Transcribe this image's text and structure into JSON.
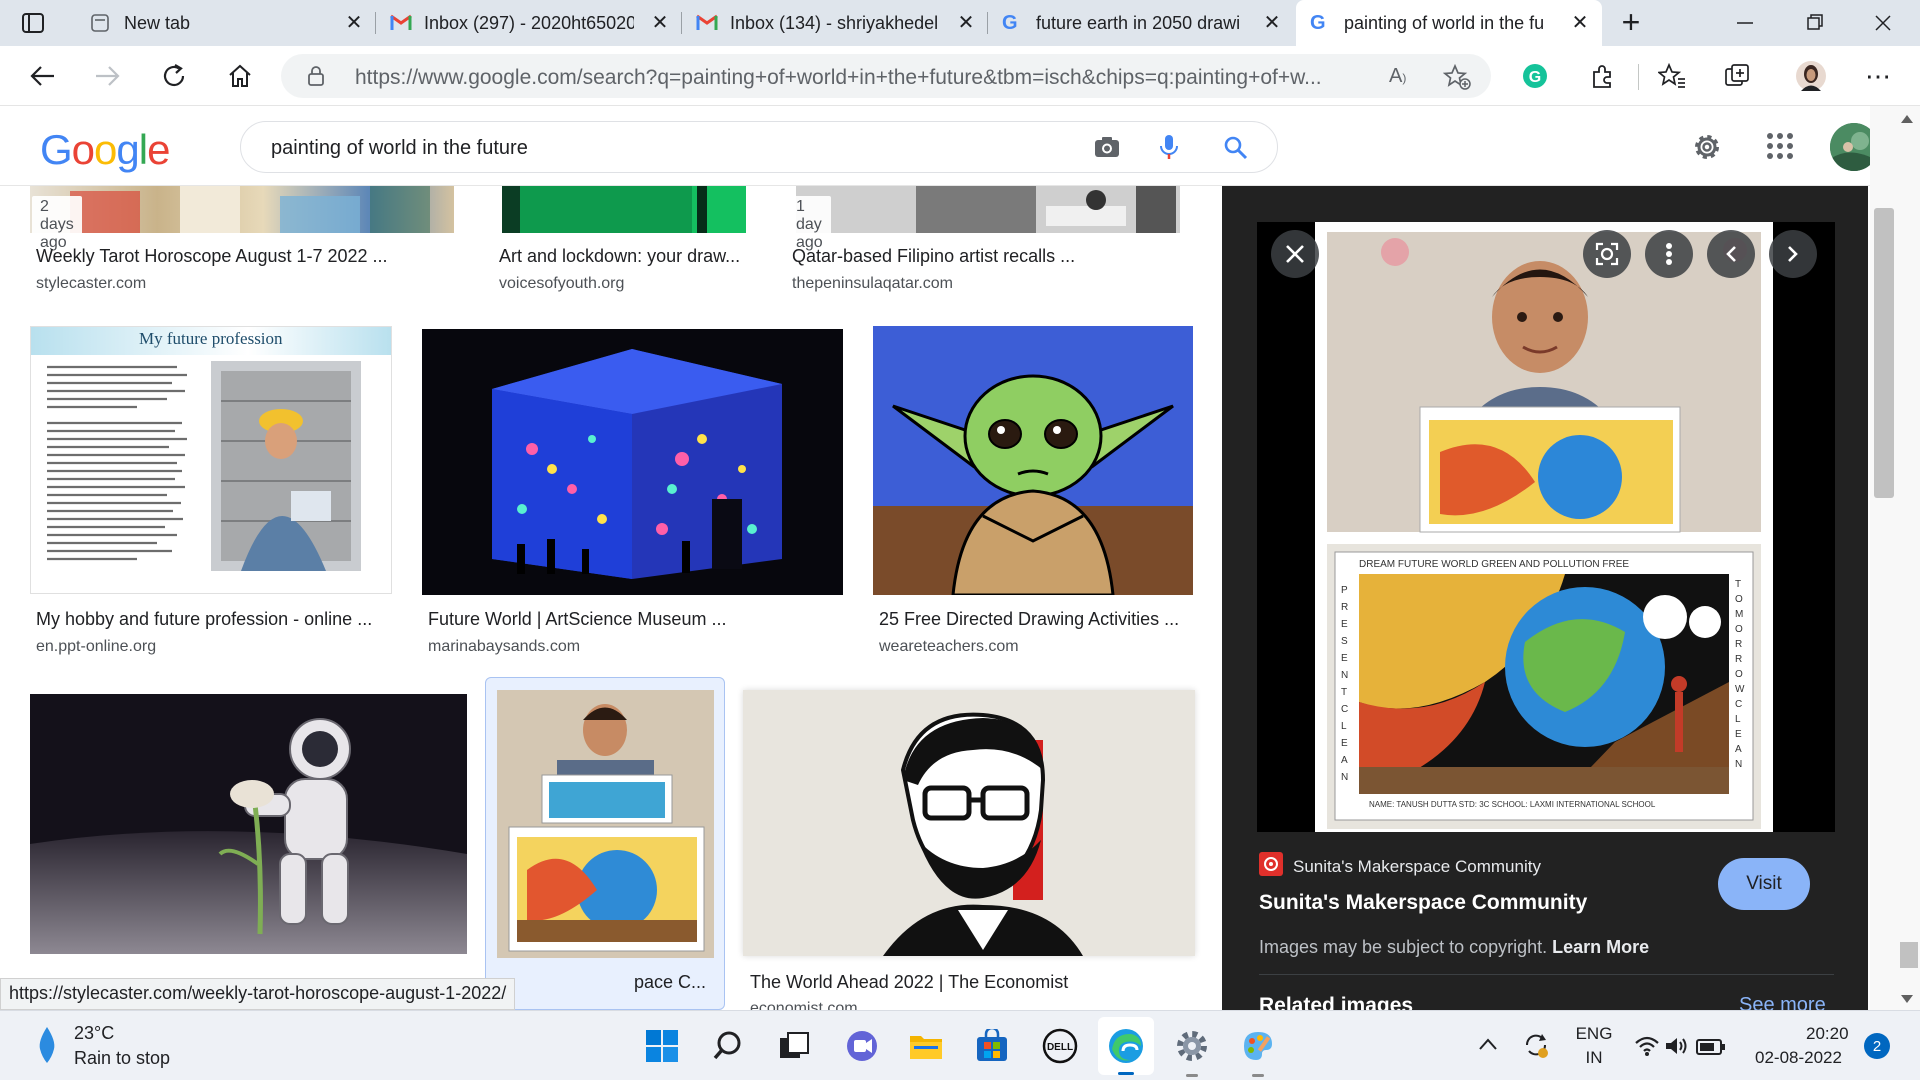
{
  "tabs": [
    {
      "label": "New tab",
      "icon": "new-tab-page-icon"
    },
    {
      "label": "Inbox (297) - 2020ht65020",
      "icon": "gmail-icon"
    },
    {
      "label": "Inbox (134) - shriyakhedel",
      "icon": "gmail-icon"
    },
    {
      "label": "future earth in 2050 drawi",
      "icon": "google-icon"
    },
    {
      "label": "painting of world in the fu",
      "icon": "google-icon"
    }
  ],
  "address_bar": {
    "url": "https://www.google.com/search?q=painting+of+world+in+the+future&tbm=isch&chips=q:painting+of+w..."
  },
  "google": {
    "logo": "Google",
    "query": "painting of world in the future"
  },
  "results": [
    {
      "title": "Weekly Tarot Horoscope August 1-7 2022 ...",
      "site": "stylecaster.com",
      "ago": "2 days ago"
    },
    {
      "title": "Art and lockdown: your draw...",
      "site": "voicesofyouth.org"
    },
    {
      "title": "Qatar-based Filipino artist recalls ...",
      "site": "thepeninsulaqatar.com",
      "ago": "1 day ago"
    },
    {
      "title": "My hobby and future profession - online ...",
      "site": "en.ppt-online.org",
      "overlay": "My future profession"
    },
    {
      "title": "Future World | ArtScience Museum ...",
      "site": "marinabaysands.com"
    },
    {
      "title": "25 Free Directed Drawing Activities ...",
      "site": "weareteachers.com"
    },
    {
      "title": "",
      "site": ""
    },
    {
      "title": "pace C...",
      "site": ""
    },
    {
      "title": "The World Ahead 2022 | The Economist",
      "site": "economist.com"
    }
  ],
  "preview": {
    "source_small": "Sunita's Makerspace Community",
    "title": "Sunita's Makerspace Community",
    "visit_label": "Visit",
    "copyright": "Images may be subject to copyright.",
    "learn_more": "Learn More",
    "related": "Related images",
    "see_more": "See more",
    "drawing_header": "DREAM FUTURE   WORLD GREEN AND POLLUTION FREE",
    "drawing_left": "PRESENT CLEAN",
    "drawing_right": "TOMORROW CLEAN",
    "drawing_footer": "NAME: TANUSH DUTTA  STD: 3C    SCHOOL: LAXMI INTERNATIONAL SCHOOL"
  },
  "status_url": "https://stylecaster.com/weekly-tarot-horoscope-august-1-2022/",
  "taskbar": {
    "weather_temp": "23°C",
    "weather_desc": "Rain to stop",
    "lang_top": "ENG",
    "lang_bottom": "IN",
    "time": "20:20",
    "date": "02-08-2022",
    "notification_count": "2"
  },
  "colors": {
    "accent_blue": "#1a73e8",
    "visit_button": "#8ab4f8",
    "preview_bg": "#222222",
    "tabstrip_bg": "#dfe5ec"
  }
}
